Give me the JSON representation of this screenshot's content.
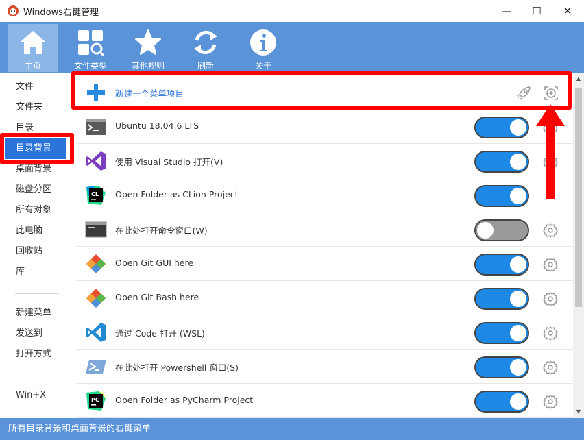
{
  "window": {
    "title": "Windows右键管理",
    "minimize": "—",
    "maximize": "☐",
    "close": "✕"
  },
  "toolbar": {
    "items": [
      {
        "label": "主页",
        "icon": "home-icon"
      },
      {
        "label": "文件类型",
        "icon": "file-types-icon"
      },
      {
        "label": "其他规则",
        "icon": "star-icon"
      },
      {
        "label": "刷新",
        "icon": "refresh-icon"
      },
      {
        "label": "关于",
        "icon": "info-icon"
      }
    ],
    "colors": {
      "background": "#5a93d8",
      "active": "#8cb6e6"
    }
  },
  "sidebar": {
    "items": [
      "文件",
      "文件夹",
      "目录",
      "目录背景",
      "桌面背景",
      "磁盘分区",
      "所有对象",
      "此电脑",
      "回收站",
      "库"
    ],
    "items2": [
      "新建菜单",
      "发送到",
      "打开方式"
    ],
    "items3": [
      "Win+X"
    ],
    "selected": "目录背景"
  },
  "list": {
    "new_item": "新建一个菜单项目",
    "items": [
      {
        "label": "Ubuntu 18.04.6 LTS",
        "on": true,
        "icon": "terminal-icon"
      },
      {
        "label": "使用 Visual Studio 打开(V)",
        "on": true,
        "icon": "visual-studio-icon"
      },
      {
        "label": "Open Folder as CLion Project",
        "on": true,
        "icon": "clion-icon"
      },
      {
        "label": "在此处打开命令窗口(W)",
        "on": false,
        "icon": "cmd-icon"
      },
      {
        "label": "Open Git GUI here",
        "on": true,
        "icon": "git-icon"
      },
      {
        "label": "Open Git Bash here",
        "on": true,
        "icon": "git-icon"
      },
      {
        "label": "通过 Code 打开 (WSL)",
        "on": true,
        "icon": "vscode-icon"
      },
      {
        "label": "在此处打开 Powershell 窗口(S)",
        "on": true,
        "icon": "powershell-icon"
      },
      {
        "label": "Open Folder as PyCharm Project",
        "on": true,
        "icon": "pycharm-icon"
      }
    ],
    "colors": {
      "toggle_on": "#1e88e5",
      "toggle_off": "#9a9a9a",
      "highlight": "#ff0000"
    }
  },
  "statusbar": {
    "text": "所有目录背景和桌面背景的右键菜单"
  }
}
